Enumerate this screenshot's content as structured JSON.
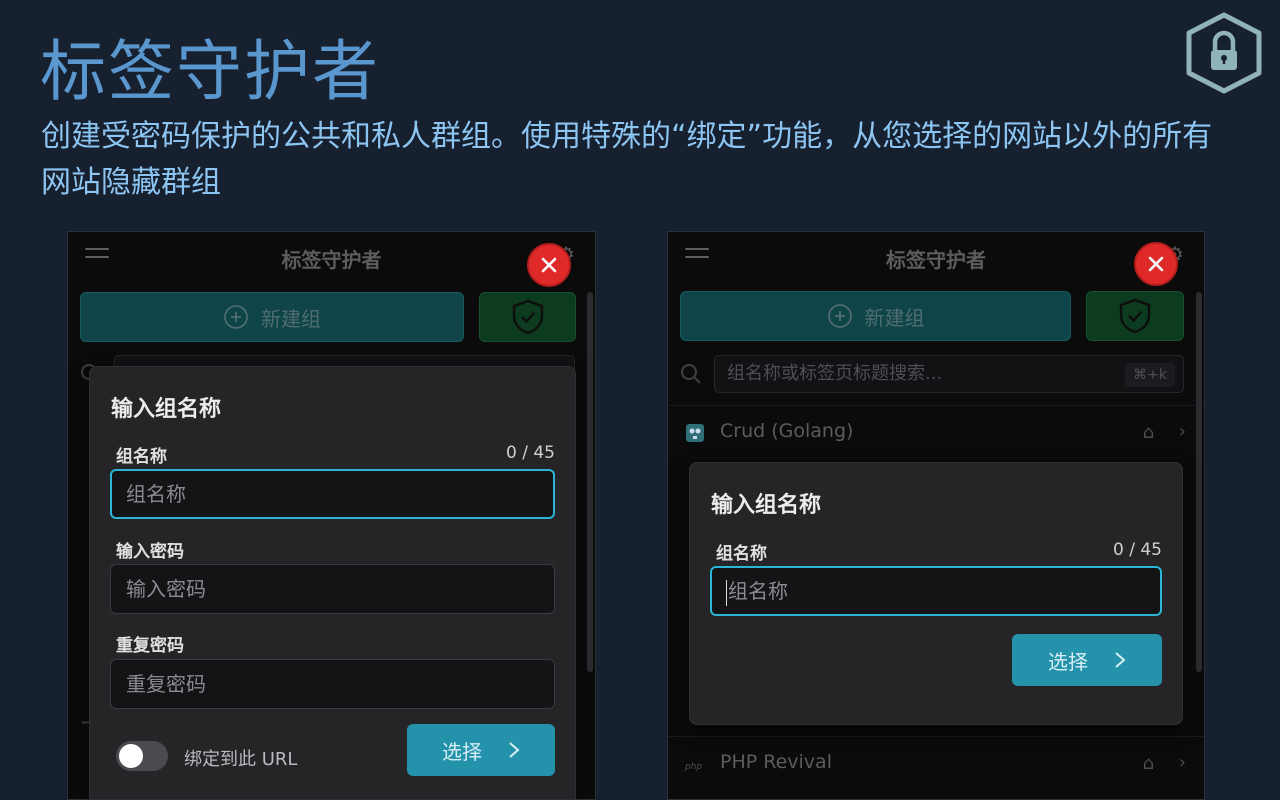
{
  "hero": {
    "title": "标签守护者",
    "subtitle": "创建受密码保护的公共和私人群组。使用特殊的“绑定”功能，从您选择的网站以外的所有网站隐藏群组"
  },
  "colors": {
    "background": "#17202e",
    "title": "#5b97cf",
    "subtitle": "#8cc4f2",
    "accent": "#2592ab",
    "focus_border": "#2ab4d6",
    "close_button": "#e02a2a"
  },
  "app": {
    "title": "标签守护者",
    "new_group_label": "新建组",
    "search_placeholder": "组名称或标签页标题搜索...",
    "search_shortcut": "⌘+k"
  },
  "left_dialog": {
    "title": "输入组名称",
    "name_label": "组名称",
    "name_counter": "0 / 45",
    "name_placeholder": "组名称",
    "password_label": "输入密码",
    "password_placeholder": "输入密码",
    "repeat_label": "重复密码",
    "repeat_placeholder": "重复密码",
    "bind_label": "绑定到此 URL",
    "bind_enabled": false,
    "select_label": "选择"
  },
  "right_list": {
    "items": [
      {
        "label": "Crud (Golang)",
        "icon": "gopher-icon"
      },
      {
        "label": "PHP Revival",
        "icon": "php-icon"
      }
    ]
  },
  "right_dialog": {
    "title": "输入组名称",
    "name_label": "组名称",
    "name_counter": "0 / 45",
    "name_placeholder": "组名称",
    "select_label": "选择"
  },
  "icons": [
    "lock-shield-logo-icon",
    "hamburger-menu-icon",
    "gear-icon",
    "close-icon",
    "plus-circle-icon",
    "shield-check-icon",
    "search-icon",
    "pin-icon",
    "chevron-right-icon"
  ]
}
